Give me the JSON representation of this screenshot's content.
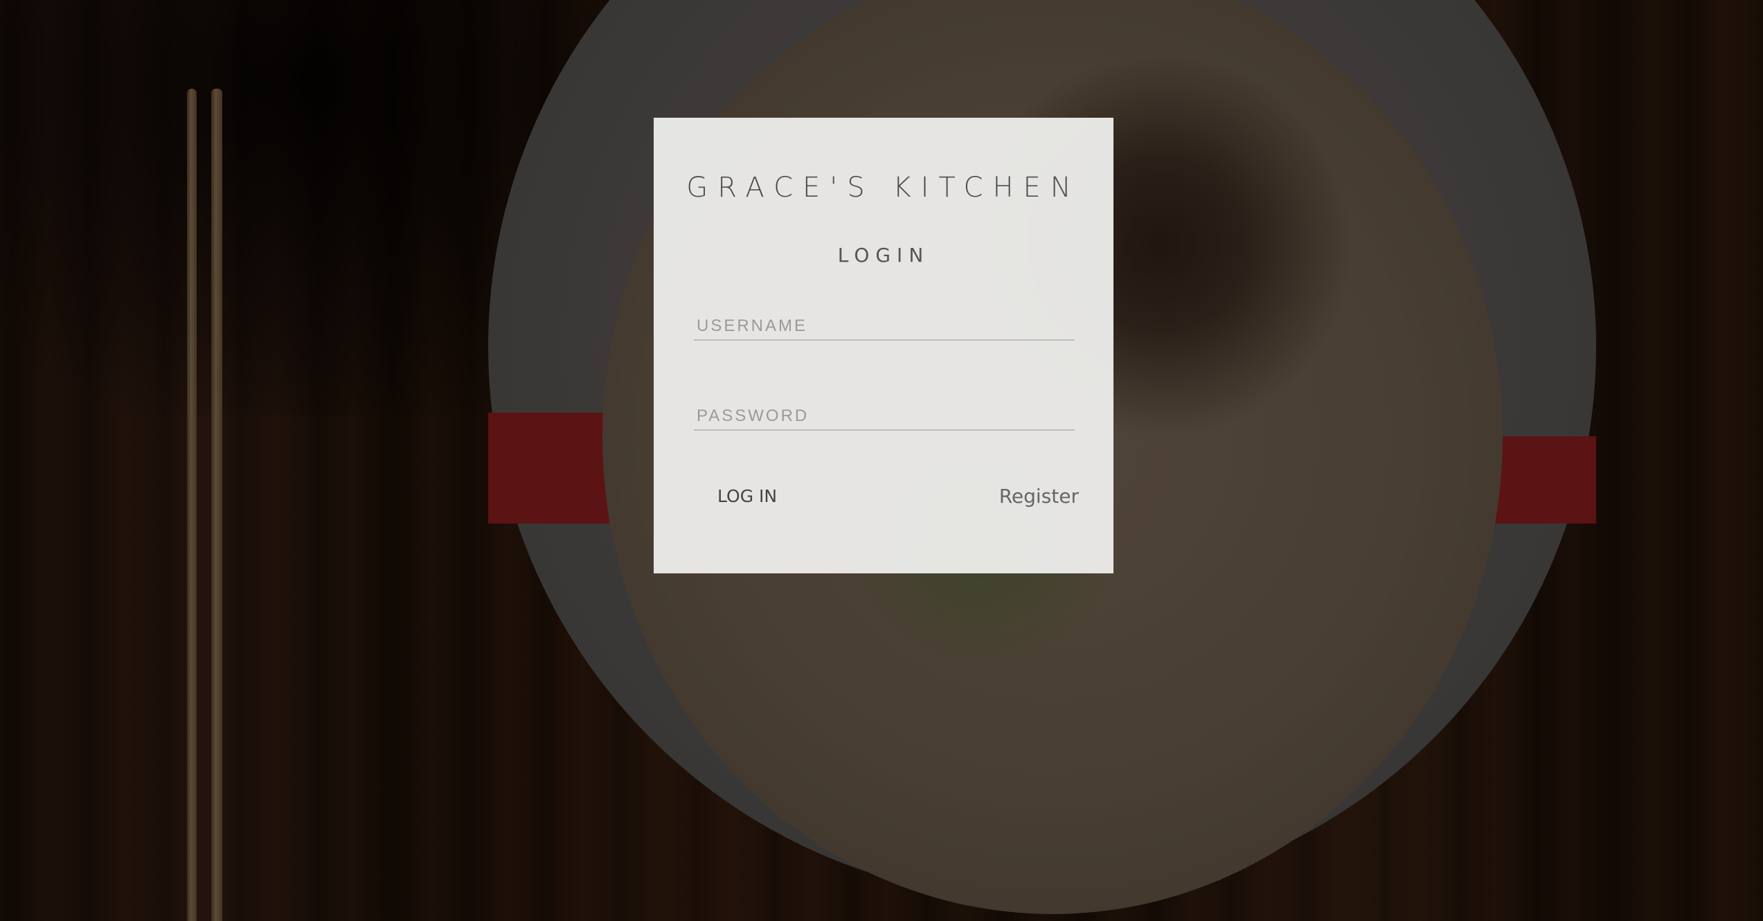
{
  "brand": {
    "title": "GRACE'S KITCHEN"
  },
  "login": {
    "heading": "LOGIN",
    "username_placeholder": "USERNAME",
    "password_placeholder": "PASSWORD",
    "submit_label": "LOG IN",
    "register_label": "Register"
  }
}
